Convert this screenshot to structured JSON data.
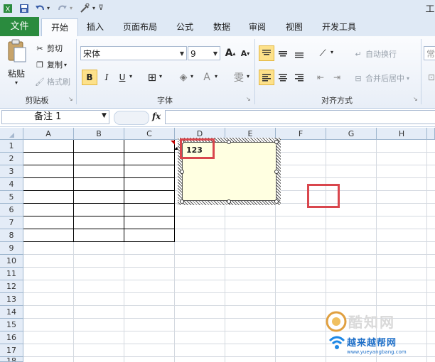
{
  "titlebar": {
    "title_fragment": "工"
  },
  "tabs": {
    "file": "文件",
    "home": "开始",
    "insert": "插入",
    "page_layout": "页面布局",
    "formulas": "公式",
    "data": "数据",
    "review": "审阅",
    "view": "视图",
    "developer": "开发工具"
  },
  "clipboard": {
    "paste": "粘贴",
    "cut": "剪切",
    "copy": "复制",
    "format_painter": "格式刷",
    "label": "剪贴板"
  },
  "font": {
    "name": "宋体",
    "size": "9",
    "label": "字体",
    "bold": "B",
    "italic": "I",
    "underline": "U",
    "grow": "A",
    "shrink": "A",
    "color_a": "A",
    "phonetic": "雯"
  },
  "alignment": {
    "wrap_text": "自动换行",
    "merge_center": "合并后居中",
    "label": "对齐方式"
  },
  "number": {
    "partial": "常"
  },
  "formula_bar": {
    "name_box": "备注 1",
    "fx": "fx"
  },
  "columns": [
    "A",
    "B",
    "C",
    "D",
    "E",
    "F",
    "G",
    "H"
  ],
  "rows": [
    "1",
    "2",
    "3",
    "4",
    "5",
    "6",
    "7",
    "8",
    "9",
    "10",
    "11",
    "12",
    "13",
    "14",
    "15",
    "16",
    "17",
    "18"
  ],
  "comment": {
    "text": "123"
  },
  "watermark": {
    "line1": "酷知网",
    "line2": "越来越帮网",
    "url": "www.yueyangbang.com"
  },
  "colors": {
    "file_tab": "#2a8b3e",
    "ribbon_bg": "#e8eef7",
    "highlight": "#d9464d",
    "comment_bg": "#ffffe1"
  }
}
